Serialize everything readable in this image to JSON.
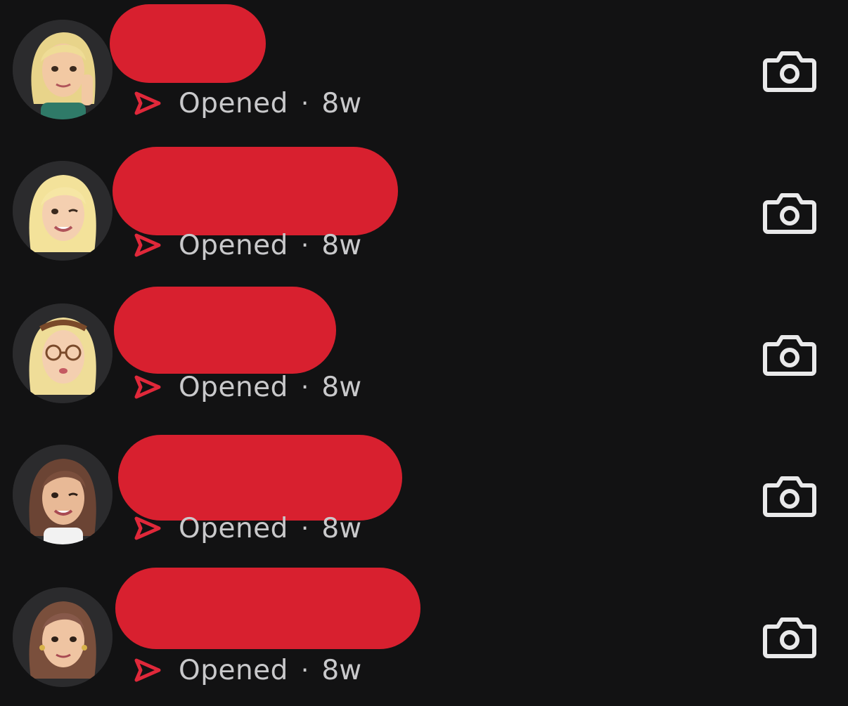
{
  "colors": {
    "background": "#121213",
    "redaction": "#d8202f",
    "sent_icon": "#e0283a",
    "status_text": "#c9c9cb",
    "camera_icon": "#e9e9ea"
  },
  "icons": {
    "sent": "sent-arrow-outline-icon",
    "camera": "camera-icon"
  },
  "chats": [
    {
      "status": "Opened",
      "separator": "·",
      "age": "8w"
    },
    {
      "status": "Opened",
      "separator": "·",
      "age": "8w"
    },
    {
      "status": "Opened",
      "separator": "·",
      "age": "8w"
    },
    {
      "status": "Opened",
      "separator": "·",
      "age": "8w"
    },
    {
      "status": "Opened",
      "separator": "·",
      "age": "8w"
    }
  ]
}
